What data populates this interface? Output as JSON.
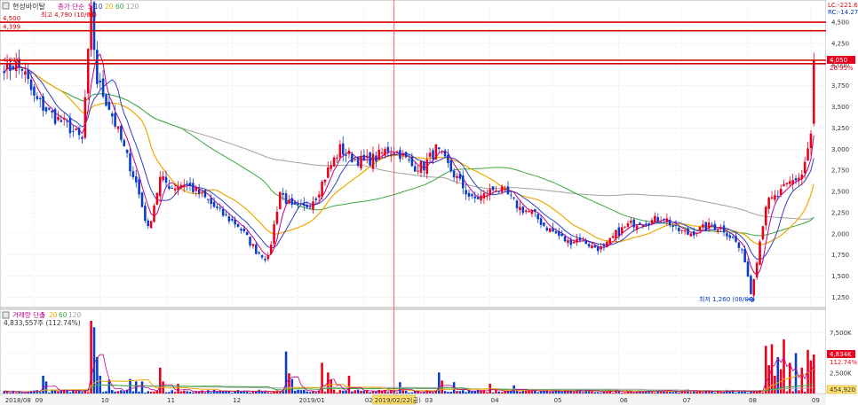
{
  "stock_name": "현성바이탈",
  "price_legend": {
    "label": "종가 단순",
    "periods": [
      "5",
      "10",
      "20",
      "60",
      "120"
    ]
  },
  "volume_legend": {
    "label": "거래량 단순",
    "periods": [
      "5",
      "20",
      "60",
      "120"
    ]
  },
  "volume_current": "4,833,557주 (112.74%)",
  "top_right": {
    "lc": "LC:-221.65",
    "rc": "RC:-14.27"
  },
  "annotations": {
    "high": "최고 4,790 (10/05)",
    "low": "최저 1,260 (08/06)",
    "cursor_date": "2019/02/22(금)"
  },
  "hlines": [
    {
      "value": 4500,
      "label": "4,500"
    },
    {
      "value": 4399,
      "label": "4,399"
    },
    {
      "value": 4010,
      "label": "4,010"
    }
  ],
  "current_price": {
    "value": 4050,
    "label": "4,050",
    "pct": "26.95%"
  },
  "volume_badges": {
    "current": "4,834K",
    "pct": "112.74%",
    "bottom": "454,920"
  },
  "colors": {
    "up": "#e8001c",
    "down": "#0a3ccc",
    "hline": "#d40000",
    "ma5": "#c0008c",
    "ma10": "#3040c0",
    "ma20": "#f0a800",
    "ma60": "#3aa840",
    "ma120": "#a0a0a0"
  },
  "chart_data": {
    "type": "candlestick",
    "x_labels": [
      "2018/08",
      "09",
      "10",
      "11",
      "12",
      "2019/01",
      "02",
      "03",
      "04",
      "05",
      "06",
      "07",
      "08",
      "09"
    ],
    "price_axis": {
      "ticks": [
        1250,
        1500,
        1750,
        2000,
        2250,
        2500,
        2750,
        3000,
        3250,
        3500,
        3750,
        4000,
        4250,
        4500
      ],
      "labels": [
        "1,250",
        "1,500",
        "1,750",
        "2,000",
        "2,250",
        "2,500",
        "2,750",
        "3,000",
        "3,250",
        "3,500",
        "3,750",
        "4,000",
        "4,250",
        "4,500"
      ],
      "range": [
        1150,
        4720
      ]
    },
    "volume_axis": {
      "ticks": [
        2500000,
        5000000,
        7500000
      ],
      "labels": [
        "2,500K",
        "5,000K",
        "7,500K"
      ],
      "range": [
        0,
        9000000
      ]
    },
    "anchors": [
      [
        0,
        3900
      ],
      [
        3,
        4000
      ],
      [
        6,
        3960
      ],
      [
        10,
        3600
      ],
      [
        16,
        3400
      ],
      [
        22,
        3250
      ],
      [
        26,
        3100
      ],
      [
        29,
        4600
      ],
      [
        31,
        3800
      ],
      [
        35,
        3500
      ],
      [
        40,
        3000
      ],
      [
        44,
        2600
      ],
      [
        48,
        2050
      ],
      [
        52,
        2650
      ],
      [
        56,
        2550
      ],
      [
        60,
        2600
      ],
      [
        66,
        2450
      ],
      [
        72,
        2250
      ],
      [
        78,
        2100
      ],
      [
        84,
        1800
      ],
      [
        88,
        1700
      ],
      [
        92,
        2500
      ],
      [
        96,
        2300
      ],
      [
        100,
        2300
      ],
      [
        104,
        2450
      ],
      [
        108,
        2750
      ],
      [
        112,
        3000
      ],
      [
        116,
        2900
      ],
      [
        120,
        2850
      ],
      [
        124,
        2900
      ],
      [
        128,
        3000
      ],
      [
        132,
        2950
      ],
      [
        136,
        2800
      ],
      [
        140,
        2800
      ],
      [
        144,
        3000
      ],
      [
        148,
        2800
      ],
      [
        152,
        2600
      ],
      [
        156,
        2400
      ],
      [
        160,
        2450
      ],
      [
        164,
        2550
      ],
      [
        168,
        2450
      ],
      [
        172,
        2300
      ],
      [
        176,
        2250
      ],
      [
        180,
        2100
      ],
      [
        184,
        2000
      ],
      [
        188,
        1900
      ],
      [
        192,
        1950
      ],
      [
        196,
        1850
      ],
      [
        200,
        1820
      ],
      [
        204,
        2000
      ],
      [
        208,
        2100
      ],
      [
        212,
        2150
      ],
      [
        216,
        2150
      ],
      [
        220,
        2200
      ],
      [
        224,
        2050
      ],
      [
        228,
        2000
      ],
      [
        232,
        2050
      ],
      [
        236,
        2100
      ],
      [
        240,
        2050
      ],
      [
        244,
        1900
      ],
      [
        247,
        1700
      ],
      [
        249,
        1300
      ],
      [
        251,
        1700
      ],
      [
        254,
        2350
      ],
      [
        258,
        2450
      ],
      [
        262,
        2600
      ],
      [
        266,
        2700
      ],
      [
        269,
        3150
      ],
      [
        270,
        4050
      ]
    ],
    "avg_volume": 320000,
    "volume_spikes": [
      [
        29,
        9000000
      ],
      [
        30,
        8200000
      ],
      [
        31,
        4500000
      ],
      [
        32,
        2200000
      ],
      [
        13,
        2200000
      ],
      [
        14,
        1500000
      ],
      [
        35,
        1700000
      ],
      [
        42,
        1800000
      ],
      [
        44,
        1500000
      ],
      [
        46,
        1500000
      ],
      [
        52,
        3200000
      ],
      [
        53,
        1500000
      ],
      [
        58,
        1200000
      ],
      [
        94,
        5200000
      ],
      [
        95,
        2500000
      ],
      [
        96,
        1800000
      ],
      [
        106,
        3800000
      ],
      [
        108,
        2600000
      ],
      [
        109,
        1700000
      ],
      [
        115,
        2200000
      ],
      [
        132,
        1400000
      ],
      [
        145,
        2600000
      ],
      [
        146,
        1600000
      ],
      [
        150,
        1400000
      ],
      [
        162,
        1200000
      ],
      [
        170,
        1000000
      ],
      [
        254,
        5900000
      ],
      [
        255,
        3500000
      ],
      [
        256,
        6100000
      ],
      [
        257,
        2200000
      ],
      [
        258,
        4500000
      ],
      [
        259,
        3000000
      ],
      [
        260,
        6700000
      ],
      [
        262,
        3800000
      ],
      [
        264,
        5000000
      ],
      [
        266,
        3200000
      ],
      [
        268,
        5400000
      ],
      [
        269,
        4100000
      ],
      [
        270,
        4833557
      ]
    ]
  }
}
